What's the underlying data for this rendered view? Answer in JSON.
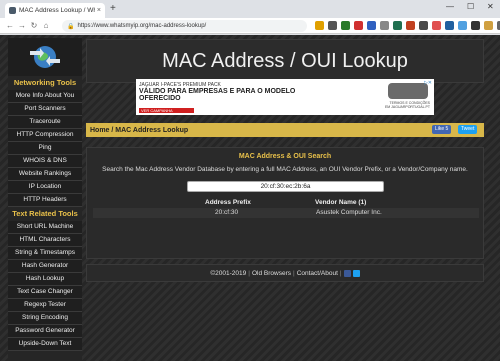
{
  "browser": {
    "tab_title": "MAC Address Lookup / WhatsM",
    "tab_close": "×",
    "new_tab": "+",
    "url": "https://www.whatsmyip.org/mac-address-lookup/",
    "controls": {
      "minimize": "—",
      "maximize": "☐",
      "close": "✕"
    }
  },
  "site": {
    "header_title": "MAC Address / OUI Lookup",
    "ad": {
      "line1": "JAGUAR I-PACE'S PREMIUM PACK",
      "line2": "VÁLIDO PARA EMPRESAS E PARA O MODELO OFERECIDO",
      "cta": "VER CAMPANHA",
      "terms": "TERMOS E CONDIÇÕES EM JAGUARPORTUGAL.PT"
    },
    "breadcrumb": "Home / MAC Address Lookup",
    "share": {
      "like": "Like 5",
      "tweet": "Tweet"
    },
    "tool": {
      "heading": "MAC Address & OUI Search",
      "description": "Search the Mac Address Vendor Database by entering a full MAC Address, an OUI Vendor Prefix, or a Vendor/Company name.",
      "input_value": "20:cf:30:ec:2b:6a",
      "columns": [
        "Address Prefix",
        "Vendor Name (1)"
      ],
      "rows": [
        {
          "prefix": "20:cf:30",
          "vendor": "Asustek Computer Inc."
        }
      ]
    },
    "footer": {
      "copyright": "©2001-2019",
      "old_browsers": "Old Browsers",
      "contact": "Contact/About"
    },
    "sidebar": {
      "networking_title": "Networking Tools",
      "networking": [
        "More Info About You",
        "Port Scanners",
        "Traceroute",
        "HTTP Compression",
        "Ping",
        "WHOIS & DNS",
        "Website Rankings",
        "IP Location",
        "HTTP Headers"
      ],
      "text_title": "Text Related Tools",
      "text": [
        "Short URL Machine",
        "HTML Characters",
        "String & Timestamps",
        "Hash Generator",
        "Hash Lookup",
        "Text Case Changer",
        "Regexp Tester",
        "String Encoding",
        "Password Generator",
        "Upside-Down Text"
      ]
    }
  },
  "colors": {
    "accent": "#e8c04a",
    "crumbbar": "#d8b749"
  }
}
